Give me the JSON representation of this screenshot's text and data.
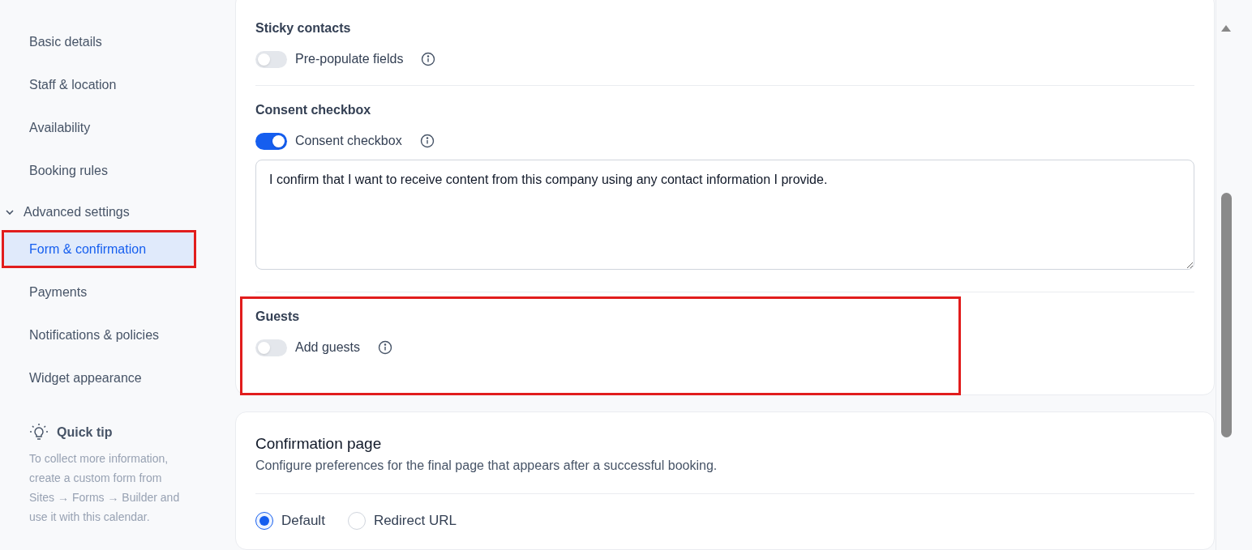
{
  "sidebar": {
    "items": [
      {
        "label": "Basic details",
        "selected": false
      },
      {
        "label": "Staff & location",
        "selected": false
      },
      {
        "label": "Availability",
        "selected": false
      },
      {
        "label": "Booking rules",
        "selected": false
      },
      {
        "label": "Advanced settings",
        "expanded": true,
        "children": [
          {
            "label": "Form & confirmation",
            "selected": true,
            "highlighted": true
          },
          {
            "label": "Payments",
            "selected": false,
            "highlighted": false
          },
          {
            "label": "Notifications & policies",
            "selected": false,
            "highlighted": false
          },
          {
            "label": "Widget appearance",
            "selected": false,
            "highlighted": false
          }
        ]
      }
    ],
    "tip": {
      "title": "Quick tip",
      "text": "To collect more information, create a custom form from Sites → Forms → Builder and use it with this calendar."
    }
  },
  "form_card": {
    "sections": [
      {
        "title": "Sticky contacts",
        "toggle": {
          "label": "Pre-populate fields",
          "on": false
        },
        "highlighted": false
      },
      {
        "title": "Consent checkbox",
        "toggle": {
          "label": "Consent checkbox",
          "on": true
        },
        "text_area": "I confirm that I want to receive content from this company using any contact information I provide.",
        "highlighted": false
      },
      {
        "title": "Guests",
        "toggle": {
          "label": "Add guests",
          "on": false
        },
        "highlighted": true
      }
    ]
  },
  "confirmation_card": {
    "title": "Confirmation page",
    "description": "Configure preferences for the final page that appears after a successful booking.",
    "options": [
      {
        "label": "Default",
        "selected": true
      },
      {
        "label": "Redirect URL",
        "selected": false
      }
    ]
  }
}
